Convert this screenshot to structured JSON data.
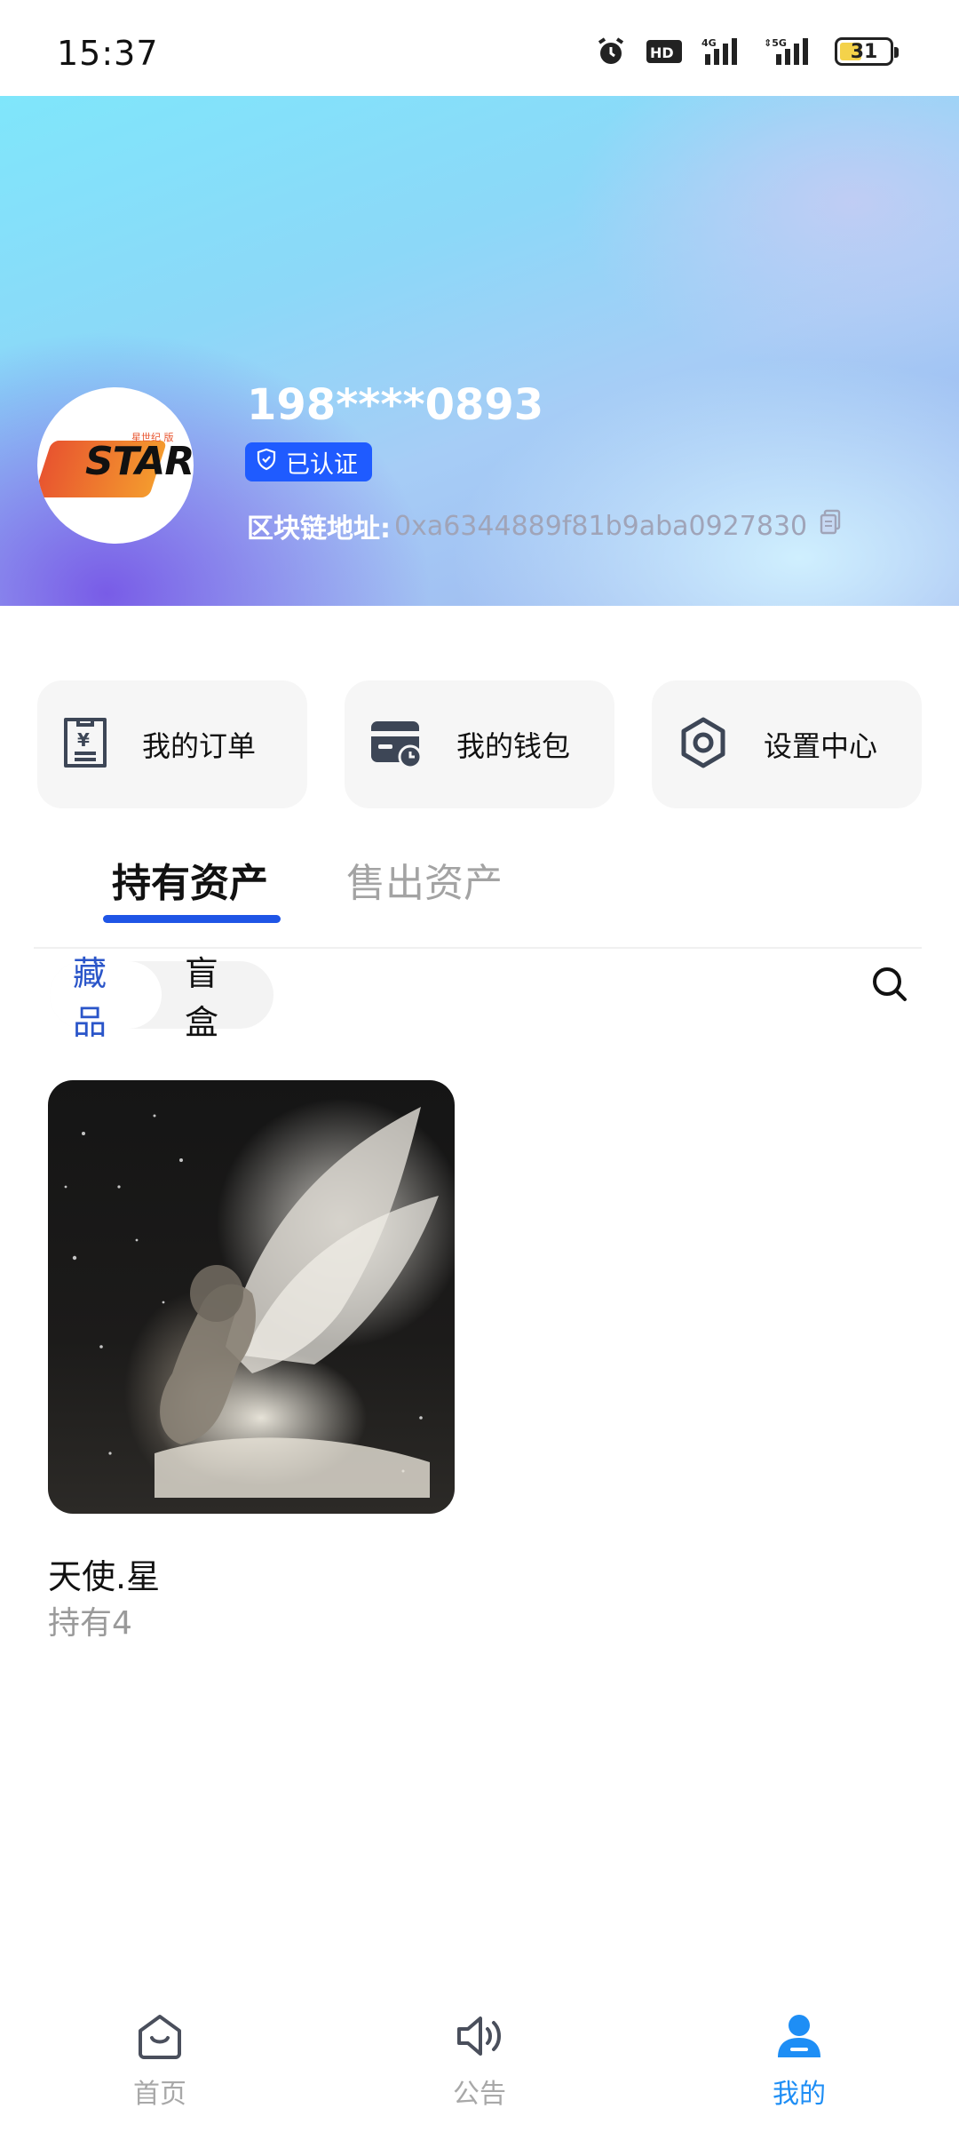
{
  "status_bar": {
    "time": "15:37",
    "network_1": "4G",
    "network_2": "5G",
    "hd_label": "HD",
    "battery_level": "31",
    "icons": [
      "alarm-icon",
      "hd-icon",
      "signal-4g-icon",
      "signal-5g-icon",
      "battery-icon"
    ]
  },
  "profile": {
    "avatar_brand": "STAR",
    "avatar_tagline": "星世纪 版",
    "username": "198****0893",
    "verified_label": "已认证",
    "chain_label": "区块链地址:",
    "chain_address": "0xa6344889f81b9aba0927830"
  },
  "actions": [
    {
      "label": "我的订单",
      "icon": "order-receipt-icon"
    },
    {
      "label": "我的钱包",
      "icon": "wallet-icon"
    },
    {
      "label": "设置中心",
      "icon": "settings-hex-icon"
    }
  ],
  "tabs": {
    "held": "持有资产",
    "sold": "售出资产",
    "active": "held"
  },
  "segment": {
    "collectibles": "藏品",
    "blind_box": "盲盒",
    "active": "collectibles"
  },
  "collection": [
    {
      "title": "天使.星",
      "count_text": "持有4",
      "image": "angel-artwork"
    }
  ],
  "bottom_nav": {
    "home": "首页",
    "notice": "公告",
    "mine": "我的",
    "active": "mine"
  },
  "colors": {
    "accent_blue": "#1f55e6",
    "nav_active": "#1e8ef5",
    "verify_badge": "#1f5bff"
  }
}
